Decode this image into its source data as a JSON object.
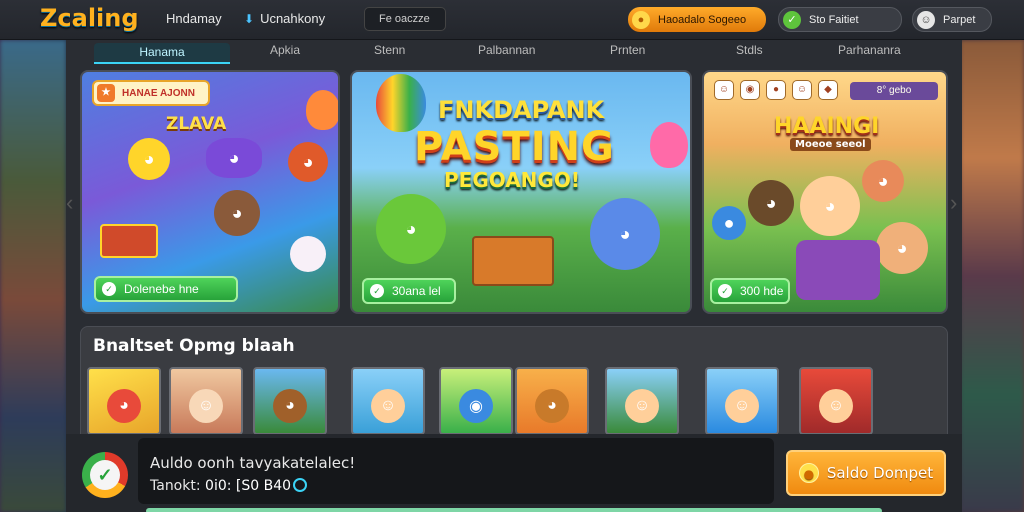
{
  "header": {
    "logo": "Zcaling",
    "nav": [
      "Hndamay",
      "Ucnahkony"
    ],
    "search_placeholder": "Fe oaczze",
    "pill_orange": "Haoadalo Sogeeo",
    "pill_dark": "Sto Faitiet",
    "pill_grey": "Parpet"
  },
  "tabs": [
    "Hanama",
    "Apkia",
    "Stenn",
    "Palbannan",
    "Prnten",
    "Stdls",
    "Parhananra"
  ],
  "cards": [
    {
      "badge": "HANAE AJONN",
      "heading": "ZLAVA",
      "button": "Dolenebe hne"
    },
    {
      "heading_top": "FNKDAPANK",
      "heading_main": "PASTING",
      "heading_sub": "PEGOANGO!",
      "button": "30ana lel"
    },
    {
      "mini_pill": "8° gebo",
      "heading_main": "HAAINGI",
      "heading_sub": "Moeoe seeol",
      "button": "300 hde"
    }
  ],
  "section": {
    "title": "Bnaltset Opmg blaah",
    "thumb_count": 9
  },
  "bottom": {
    "line1": "Auldo oonh tavyakatelalec!",
    "line2_label": "Tanokt:",
    "line2_value": "0i0: [S0 B40",
    "saldo_button": "Saldo Dompet"
  },
  "colors": {
    "accent_cyan": "#3bd3f5",
    "accent_orange": "#f08a10",
    "accent_green": "#27a33a"
  }
}
